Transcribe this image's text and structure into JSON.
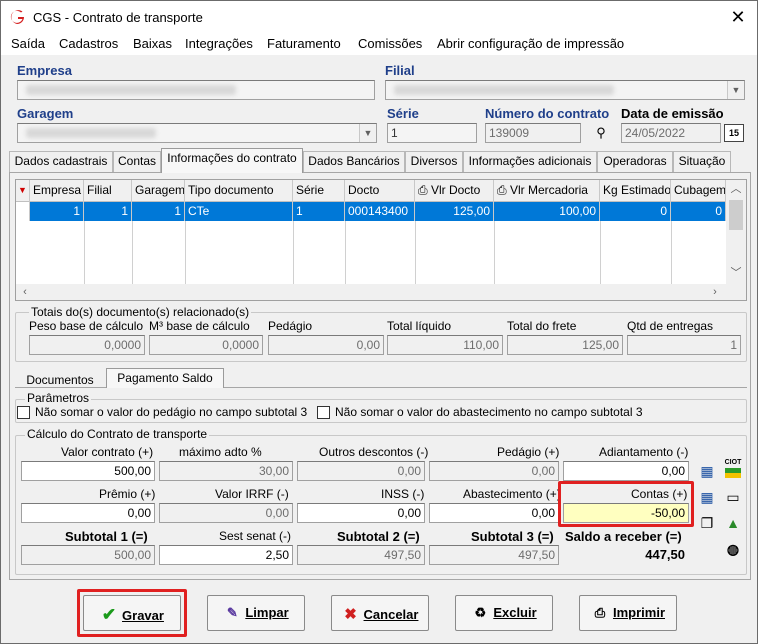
{
  "window": {
    "title": "CGS - Contrato de transporte",
    "close_glyph": "✕"
  },
  "menu": [
    "Saída",
    "Cadastros",
    "Baixas",
    "Integrações",
    "Faturamento",
    "Comissões",
    "Abrir configuração de impressão"
  ],
  "header": {
    "empresa_label": "Empresa",
    "filial_label": "Filial",
    "garagem_label": "Garagem",
    "serie_label": "Série",
    "serie_value": "1",
    "numero_contrato_label": "Número do contrato",
    "numero_contrato_value": "139009",
    "data_emissao_label": "Data de emissão",
    "data_emissao_value": "24/05/2022",
    "calendar_glyph": "15"
  },
  "tabs": [
    "Dados cadastrais",
    "Contas",
    "Informações do contrato",
    "Dados Bancários",
    "Diversos",
    "Informações adicionais",
    "Operadoras",
    "Situação"
  ],
  "grid": {
    "columns": [
      "Empresa",
      "Filial",
      "Garagem",
      "Tipo documento",
      "Série",
      "Docto",
      "Vlr Docto",
      "Vlr Mercadoria",
      "Kg Estimado",
      "Cubagem"
    ],
    "rows": [
      [
        "1",
        "1",
        "1",
        "CTe",
        "1",
        "000143400",
        "125,00",
        "100,00",
        "0",
        "0"
      ]
    ]
  },
  "totais": {
    "title": "Totais do(s) documento(s) relacionado(s)",
    "peso_base_label": "Peso base de cálculo",
    "peso_base_value": "0,0000",
    "m3_base_label": "M³ base de cálculo",
    "m3_base_value": "0,0000",
    "pedagio_label": "Pedágio",
    "pedagio_value": "0,00",
    "total_liquido_label": "Total líquido",
    "total_liquido_value": "110,00",
    "total_frete_label": "Total do frete",
    "total_frete_value": "125,00",
    "qtd_entregas_label": "Qtd de entregas",
    "qtd_entregas_value": "1"
  },
  "subtabs": [
    "Documentos",
    "Pagamento Saldo"
  ],
  "parametros": {
    "title": "Parâmetros",
    "check1_label": "Não somar o valor do pedágio no campo subtotal 3",
    "check2_label": "Não somar o valor do abastecimento no campo subtotal 3"
  },
  "calculo": {
    "title": "Cálculo do Contrato de transporte",
    "valor_contrato_label": "Valor contrato (+)",
    "valor_contrato_value": "500,00",
    "maximo_adto_label": "máximo adto %",
    "maximo_adto_value": "30,00",
    "outros_descontos_label": "Outros descontos (-)",
    "outros_descontos_value": "0,00",
    "pedagio_label": "Pedágio (+)",
    "pedagio_value": "0,00",
    "adiantamento_label": "Adiantamento (-)",
    "adiantamento_value": "0,00",
    "premio_label": "Prêmio (+)",
    "premio_value": "0,00",
    "valor_irrf_label": "Valor IRRF (-)",
    "valor_irrf_value": "0,00",
    "inss_label": "INSS (-)",
    "inss_value": "0,00",
    "abastecimento_label": "Abastecimento (+)",
    "abastecimento_value": "0,00",
    "contas_label": "Contas (+)",
    "contas_value": "-50,00",
    "subtotal1_label": "Subtotal 1 (=)",
    "subtotal1_value": "500,00",
    "sest_senat_label": "Sest senat (-)",
    "sest_senat_value": "2,50",
    "subtotal2_label": "Subtotal 2 (=)",
    "subtotal2_value": "497,50",
    "subtotal3_label": "Subtotal 3 (=)",
    "subtotal3_value": "497,50",
    "saldo_receber_label": "Saldo a receber (=)",
    "saldo_receber_value": "447,50",
    "ciot_badge": "CIOT"
  },
  "buttons": {
    "gravar": "Gravar",
    "limpar": "Limpar",
    "cancelar": "Cancelar",
    "excluir": "Excluir",
    "imprimir": "Imprimir"
  },
  "colors": {
    "accent_blue": "#1f3f8a",
    "selection": "#0078d7",
    "highlight_red": "#e02020",
    "contas_field": "#ffffc0"
  }
}
